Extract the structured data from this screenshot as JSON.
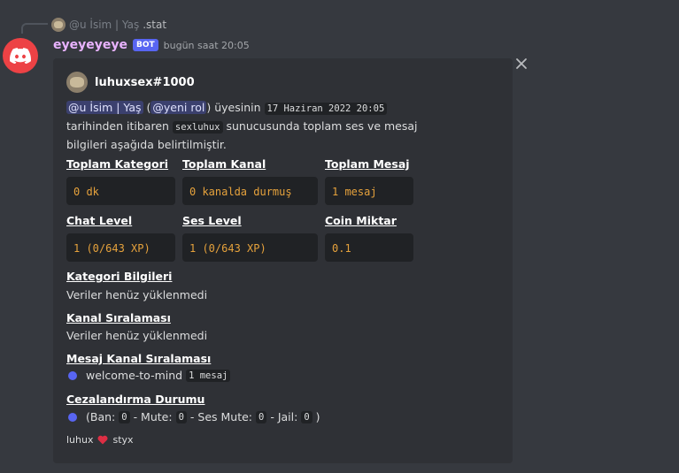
{
  "reply": {
    "mention": "@u İsim | Yaş",
    "text": ".stat"
  },
  "message": {
    "username": "eyeyeyeye",
    "bot_badge": "BOT",
    "timestamp": "bugün saat 20:05"
  },
  "embed": {
    "author": "luhuxsex#1000",
    "description": {
      "mention1": "@u İsim | Yaş",
      "open_paren": "(",
      "mention2": "@yeni rol",
      "close_paren": ")",
      "text1": "üyesinin",
      "date": "17 Haziran 2022 20:05",
      "text2": "tarihinden itibaren",
      "server": "sexluhux",
      "text3": "sunucusunda toplam ses ve mesaj",
      "text4": "bilgileri aşağıda belirtilmiştir."
    },
    "fields": [
      {
        "title": "Toplam Kategori",
        "value": "0 dk"
      },
      {
        "title": "Toplam Kanal",
        "value": "0 kanalda durmuş"
      },
      {
        "title": "Toplam Mesaj",
        "value": "1 mesaj"
      },
      {
        "title": "Chat Level",
        "value": "1 (0/643 XP)"
      },
      {
        "title": "Ses Level",
        "value": "1 (0/643 XP)"
      },
      {
        "title": "Coin Miktar",
        "value": "0.1"
      }
    ],
    "kategori": {
      "title": "Kategori Bilgileri",
      "text": "Veriler henüz yüklenmedi"
    },
    "kanal": {
      "title": "Kanal Sıralaması",
      "text": "Veriler henüz yüklenmedi"
    },
    "mesaj_kanal": {
      "title": "Mesaj Kanal Sıralaması",
      "channel": "welcome-to-mind",
      "count": "1 mesaj"
    },
    "ceza": {
      "title": "Cezalandırma Durumu",
      "open": "(Ban:",
      "ban": "0",
      "mute_label": "- Mute:",
      "mute": "0",
      "ses_label": "- Ses Mute:",
      "ses": "0",
      "jail_label": "- Jail:",
      "jail": "0",
      "close": ")"
    },
    "footer": {
      "left": "luhux",
      "right": "styx"
    }
  },
  "colors": {
    "accent": "#5865f2",
    "code_value": "#e6a23c",
    "heart": "#dd2e44",
    "avatar_bg": "#ed4245"
  }
}
